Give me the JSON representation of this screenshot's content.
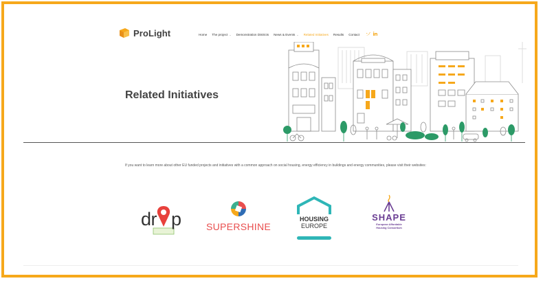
{
  "site": {
    "logo_text": "ProLight"
  },
  "nav": {
    "items": [
      {
        "label": "Home",
        "dropdown": false,
        "active": false
      },
      {
        "label": "The project",
        "dropdown": true,
        "active": false
      },
      {
        "label": "Demonstration Districts",
        "dropdown": false,
        "active": false
      },
      {
        "label": "News & Events",
        "dropdown": true,
        "active": false
      },
      {
        "label": "Related Initiatives",
        "dropdown": false,
        "active": true
      },
      {
        "label": "Results",
        "dropdown": false,
        "active": false
      },
      {
        "label": "Contact",
        "dropdown": false,
        "active": false
      }
    ],
    "social_icons": [
      "twitter-icon",
      "linkedin-icon"
    ]
  },
  "hero": {
    "title": "Related Initiatives"
  },
  "intro": {
    "text": "If you want to learn more about other EU funded projects and initiatives with a common approach on social housing, energy efficiency in buildings and energy communities, please visit their websites:"
  },
  "partners": {
    "drop": {
      "name": "drop"
    },
    "supershine": {
      "part1": "SUPER",
      "part2": "SHINE"
    },
    "housing_europe": {
      "line1": "HOUSING",
      "line2": "EUROPE"
    },
    "shape": {
      "name": "SHAPE",
      "sub1": "European Affordable",
      "sub2": "Housing Consortium"
    }
  },
  "colors": {
    "accent": "#F6A81B",
    "text_dark": "#444444",
    "drop_red": "#E8413C",
    "supershine_red": "#E94E4E",
    "housing_teal": "#2FB6B7",
    "shape_purple": "#6A3D93",
    "shape_orange": "#F6A81B"
  }
}
